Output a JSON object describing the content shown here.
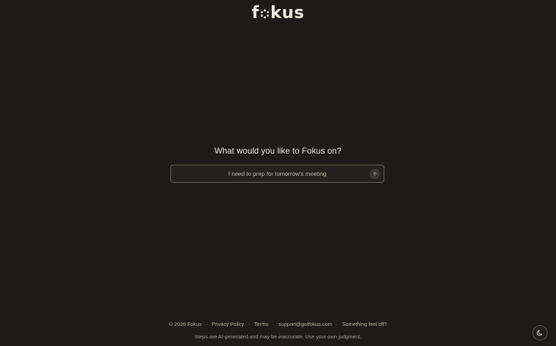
{
  "brand": {
    "logo_prefix": "f",
    "logo_suffix": "kus",
    "accent": "#f1ece2"
  },
  "main": {
    "heading": "What would you like to Fokus on?",
    "input_placeholder": "I need to prep for tomorrow's meeting",
    "submit_icon": "arrow-up-icon"
  },
  "footer": {
    "copyright": "© 2026 Fokus",
    "privacy": "Privacy Policy",
    "terms": "Terms",
    "email": "support@gotfokus.com",
    "feedback": "Something feel off?",
    "separator": "·",
    "disclaimer": "Steps are AI-generated and may be inaccurate. Use your own judgment."
  },
  "theme_toggle": {
    "icon": "moon-icon"
  },
  "colors": {
    "background": "#1d1b1a",
    "input_border": "#6e6553",
    "text": "#f0ebe2"
  }
}
